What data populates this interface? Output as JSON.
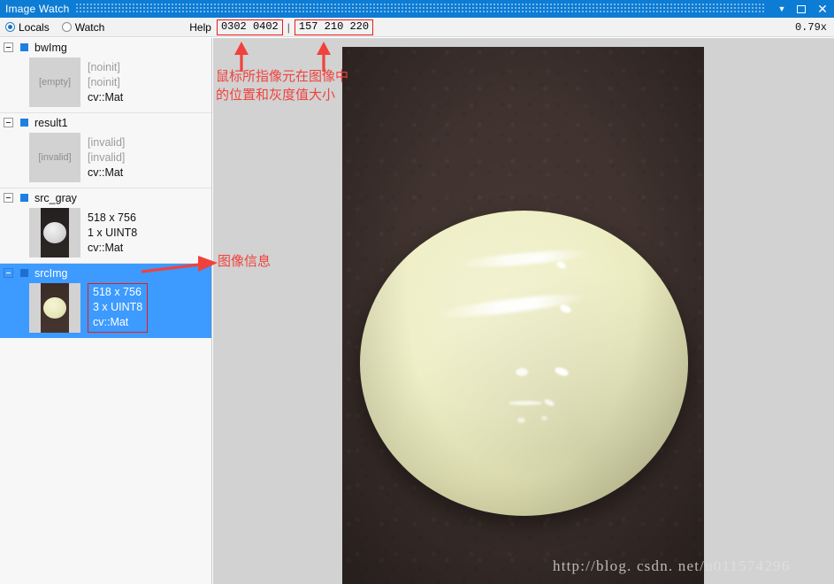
{
  "window": {
    "title": "Image Watch",
    "buttons": [
      {
        "name": "dropdown",
        "glyph": "▼"
      },
      {
        "name": "maximize",
        "glyph": ""
      },
      {
        "name": "close",
        "glyph": "✕"
      }
    ]
  },
  "toolbar": {
    "locals_label": "Locals",
    "watch_label": "Watch",
    "help_label": "Help",
    "pixel_coords": "0302 0402",
    "separator": "|",
    "pixel_values": "157 210 220",
    "zoom_level": "0.79x",
    "selected_mode": "Locals"
  },
  "tree": {
    "nodes": [
      {
        "name": "bwImg",
        "thumb_label": "[empty]",
        "meta": [
          "[noinit]",
          "[noinit]",
          "cv::Mat"
        ],
        "meta_dim": [
          true,
          true,
          false
        ],
        "selected": false,
        "thumb_kind": "placeholder"
      },
      {
        "name": "result1",
        "thumb_label": "[invalid]",
        "meta": [
          "[invalid]",
          "[invalid]",
          "cv::Mat"
        ],
        "meta_dim": [
          true,
          true,
          false
        ],
        "selected": false,
        "thumb_kind": "placeholder"
      },
      {
        "name": "src_gray",
        "thumb_label": "",
        "meta": [
          "518 x 756",
          "1 x UINT8",
          "cv::Mat"
        ],
        "meta_dim": [
          false,
          false,
          false
        ],
        "selected": false,
        "thumb_kind": "gray-egg"
      },
      {
        "name": "srcImg",
        "thumb_label": "",
        "meta": [
          "518 x 756",
          "3 x UINT8",
          "cv::Mat"
        ],
        "meta_dim": [
          false,
          false,
          false
        ],
        "selected": true,
        "thumb_kind": "color-egg"
      }
    ]
  },
  "viewer": {
    "watermark": "http://blog. csdn. net/u011574296",
    "image_subject": "egg-photo"
  },
  "annotations": {
    "pixel_info": "鼠标所指像元在图像中\n的位置和灰度值大小",
    "image_info": "图像信息",
    "color": "#f0423c"
  },
  "colors": {
    "titlebar": "#0c7cd5",
    "selection": "#3d9aff",
    "annotation_red": "#e81c1c",
    "viewer_bg": "#d2d2d2",
    "tree_bg": "#f7f7f7"
  }
}
